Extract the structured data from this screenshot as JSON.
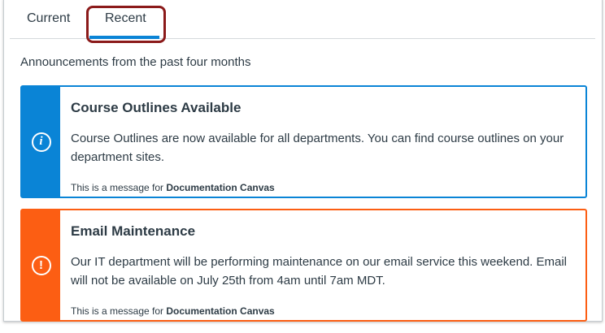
{
  "tabs": [
    {
      "label": "Current",
      "active": false
    },
    {
      "label": "Recent",
      "active": true
    }
  ],
  "subtitle": "Announcements from the past four months",
  "colors": {
    "info": "#0a84d6",
    "warning": "#fc5e13",
    "annotation": "#8b1a1a"
  },
  "announcements": [
    {
      "icon": "info-icon",
      "glyph": "i",
      "title": "Course Outlines Available",
      "body": "Course Outlines are now available for all departments. You can find course outlines on your department sites.",
      "footer_prefix": "This is a message for ",
      "footer_target": "Documentation Canvas"
    },
    {
      "icon": "warning-icon",
      "glyph": "!",
      "title": "Email Maintenance",
      "body": "Our IT department will be performing maintenance on our email service this weekend. Email will not be available on July 25th from 4am until 7am MDT.",
      "footer_prefix": "This is a message for ",
      "footer_target": "Documentation Canvas"
    }
  ]
}
